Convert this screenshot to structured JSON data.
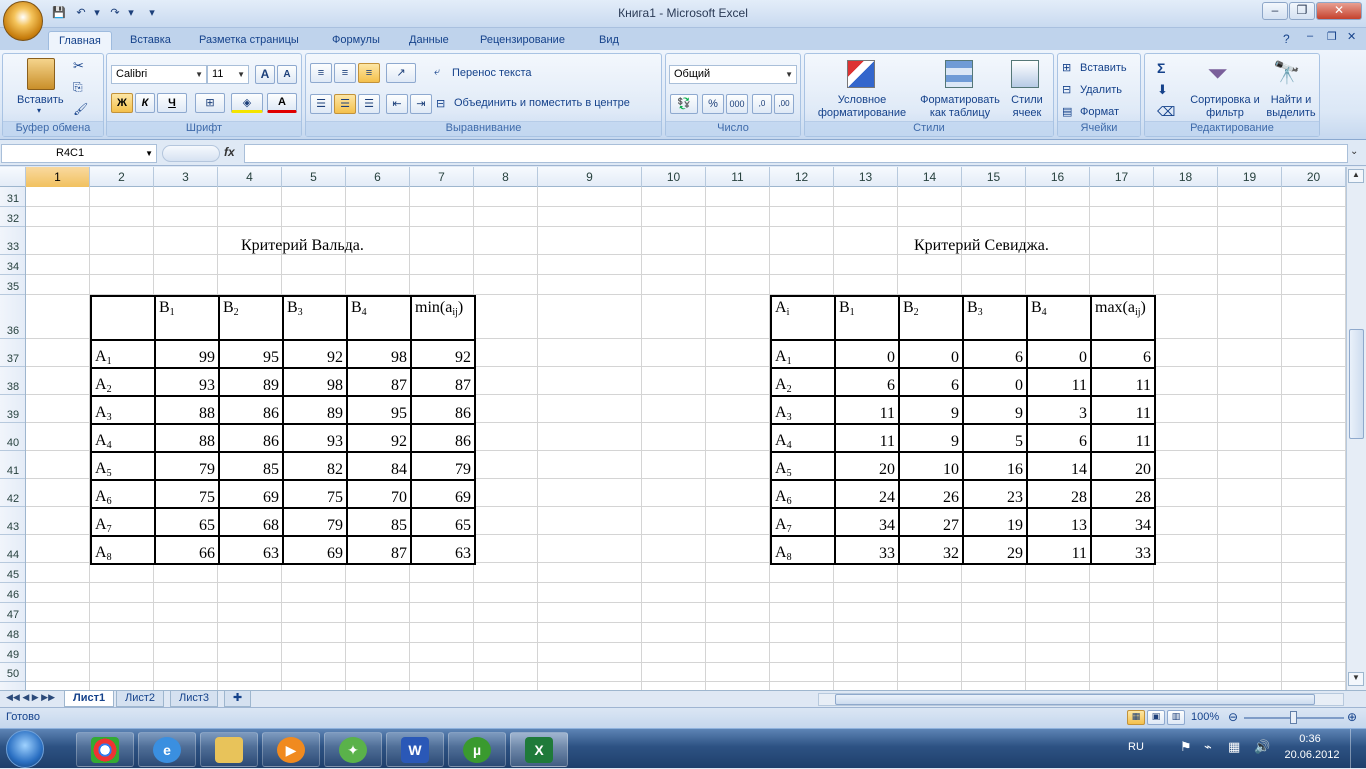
{
  "window": {
    "title": "Книга1 - Microsoft Excel"
  },
  "tabs": [
    "Главная",
    "Вставка",
    "Разметка страницы",
    "Формулы",
    "Данные",
    "Рецензирование",
    "Вид"
  ],
  "ribbon": {
    "clipboard": {
      "paste": "Вставить",
      "label": "Буфер обмена"
    },
    "font": {
      "name": "Calibri",
      "size": "11",
      "label": "Шрифт",
      "bold": "Ж",
      "italic": "К",
      "underline": "Ч"
    },
    "alignment": {
      "wrap": "Перенос текста",
      "merge": "Объединить и поместить в центре",
      "label": "Выравнивание"
    },
    "number": {
      "format": "Общий",
      "label": "Число"
    },
    "styles": {
      "conditional": "Условное форматирование",
      "as_table": "Форматировать как таблицу",
      "cell_styles": "Стили ячеек",
      "label": "Стили"
    },
    "cells": {
      "insert": "Вставить",
      "delete": "Удалить",
      "format": "Формат",
      "label": "Ячейки"
    },
    "editing": {
      "sort": "Сортировка и фильтр",
      "find": "Найти и выделить",
      "label": "Редактирование"
    }
  },
  "formula_bar": {
    "name_box": "R4C1",
    "fx": "fx",
    "value": ""
  },
  "columns": [
    "1",
    "2",
    "3",
    "4",
    "5",
    "6",
    "7",
    "8",
    "9",
    "10",
    "11",
    "12",
    "13",
    "14",
    "15",
    "16",
    "17",
    "18",
    "19",
    "20"
  ],
  "rows": [
    "31",
    "32",
    "33",
    "34",
    "35",
    "36",
    "37",
    "38",
    "39",
    "40",
    "41",
    "42",
    "43",
    "44",
    "45",
    "46",
    "47",
    "48",
    "49",
    "50"
  ],
  "wald": {
    "title": "Критерий Вальда.",
    "headers": [
      "B",
      "B",
      "B",
      "B",
      "min(a"
    ],
    "header_subs": [
      "1",
      "2",
      "3",
      "4",
      "ij"
    ],
    "row_labels": [
      "A",
      "A",
      "A",
      "A",
      "A",
      "A",
      "A",
      "A"
    ],
    "row_subs": [
      "1",
      "2",
      "3",
      "4",
      "5",
      "6",
      "7",
      "8"
    ],
    "rows": [
      [
        "99",
        "95",
        "92",
        "98",
        "92"
      ],
      [
        "93",
        "89",
        "98",
        "87",
        "87"
      ],
      [
        "88",
        "86",
        "89",
        "95",
        "86"
      ],
      [
        "88",
        "86",
        "93",
        "92",
        "86"
      ],
      [
        "79",
        "85",
        "82",
        "84",
        "79"
      ],
      [
        "75",
        "69",
        "75",
        "70",
        "69"
      ],
      [
        "65",
        "68",
        "79",
        "85",
        "65"
      ],
      [
        "66",
        "63",
        "69",
        "87",
        "63"
      ]
    ]
  },
  "savage": {
    "title": "Критерий Севиджа.",
    "corner": "A",
    "corner_sub": "i",
    "headers": [
      "B",
      "B",
      "B",
      "B",
      "max(a"
    ],
    "header_subs": [
      "1",
      "2",
      "3",
      "4",
      "ij"
    ],
    "row_labels": [
      "A",
      "A",
      "A",
      "A",
      "A",
      "A",
      "A",
      "A"
    ],
    "row_subs": [
      "1",
      "2",
      "3",
      "4",
      "5",
      "6",
      "7",
      "8"
    ],
    "rows": [
      [
        "0",
        "0",
        "6",
        "0",
        "6"
      ],
      [
        "6",
        "6",
        "0",
        "11",
        "11"
      ],
      [
        "11",
        "9",
        "9",
        "3",
        "11"
      ],
      [
        "11",
        "9",
        "5",
        "6",
        "11"
      ],
      [
        "20",
        "10",
        "16",
        "14",
        "20"
      ],
      [
        "24",
        "26",
        "23",
        "28",
        "28"
      ],
      [
        "34",
        "27",
        "19",
        "13",
        "34"
      ],
      [
        "33",
        "32",
        "29",
        "11",
        "33"
      ]
    ]
  },
  "sheets": [
    "Лист1",
    "Лист2",
    "Лист3"
  ],
  "status": {
    "ready": "Готово",
    "zoom": "100%"
  },
  "tray": {
    "lang": "RU",
    "time": "0:36",
    "date": "20.06.2012"
  },
  "colors": {
    "accent": "#15428b",
    "selected_header": "#f1c15f"
  }
}
